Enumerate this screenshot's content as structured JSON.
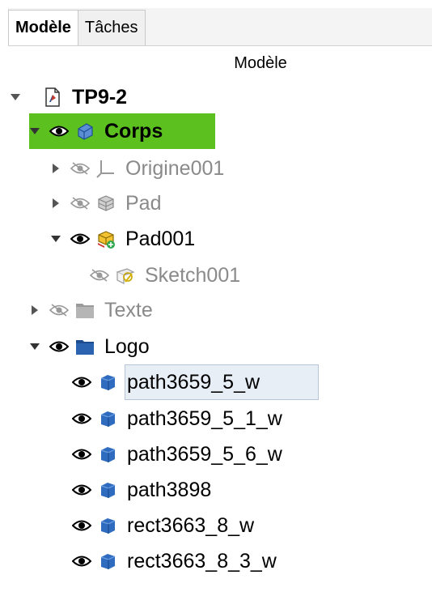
{
  "tabs": [
    {
      "label": "Modèle",
      "active": true
    },
    {
      "label": "Tâches",
      "active": false
    }
  ],
  "tree": {
    "header": "Modèle",
    "highlight_color": "#5cc11f",
    "items": [
      {
        "label": "TP9-2",
        "icon": "document-icon",
        "visibility": null,
        "expanded": true,
        "dim": false,
        "bold": true
      },
      {
        "label": "Corps",
        "icon": "body-icon",
        "visibility": "visible",
        "expanded": true,
        "dim": false,
        "bold": true,
        "highlighted": true
      },
      {
        "label": "Origine001",
        "icon": "origin-axes-icon",
        "visibility": "hidden",
        "expanded": false,
        "dim": true
      },
      {
        "label": "Pad",
        "icon": "pad-icon",
        "visibility": "hidden",
        "expanded": false,
        "dim": true
      },
      {
        "label": "Pad001",
        "icon": "pad-tip-icon",
        "visibility": "visible",
        "expanded": true,
        "dim": false
      },
      {
        "label": "Sketch001",
        "icon": "sketch-icon",
        "visibility": "hidden",
        "expanded": null,
        "dim": true
      },
      {
        "label": "Texte",
        "icon": "folder-icon",
        "visibility": "hidden",
        "expanded": false,
        "dim": true
      },
      {
        "label": "Logo",
        "icon": "folder-icon",
        "visibility": "visible",
        "expanded": true,
        "dim": false
      },
      {
        "label": "path3659_5_w",
        "icon": "solid-cube-icon",
        "visibility": "visible",
        "expanded": null,
        "dim": false,
        "selected": true
      },
      {
        "label": "path3659_5_1_w",
        "icon": "solid-cube-icon",
        "visibility": "visible",
        "expanded": null,
        "dim": false
      },
      {
        "label": "path3659_5_6_w",
        "icon": "solid-cube-icon",
        "visibility": "visible",
        "expanded": null,
        "dim": false
      },
      {
        "label": "path3898",
        "icon": "solid-cube-icon",
        "visibility": "visible",
        "expanded": null,
        "dim": false
      },
      {
        "label": "rect3663_8_w",
        "icon": "solid-cube-icon",
        "visibility": "visible",
        "expanded": null,
        "dim": false
      },
      {
        "label": "rect3663_8_3_w",
        "icon": "solid-cube-icon",
        "visibility": "visible",
        "expanded": null,
        "dim": false
      }
    ]
  }
}
